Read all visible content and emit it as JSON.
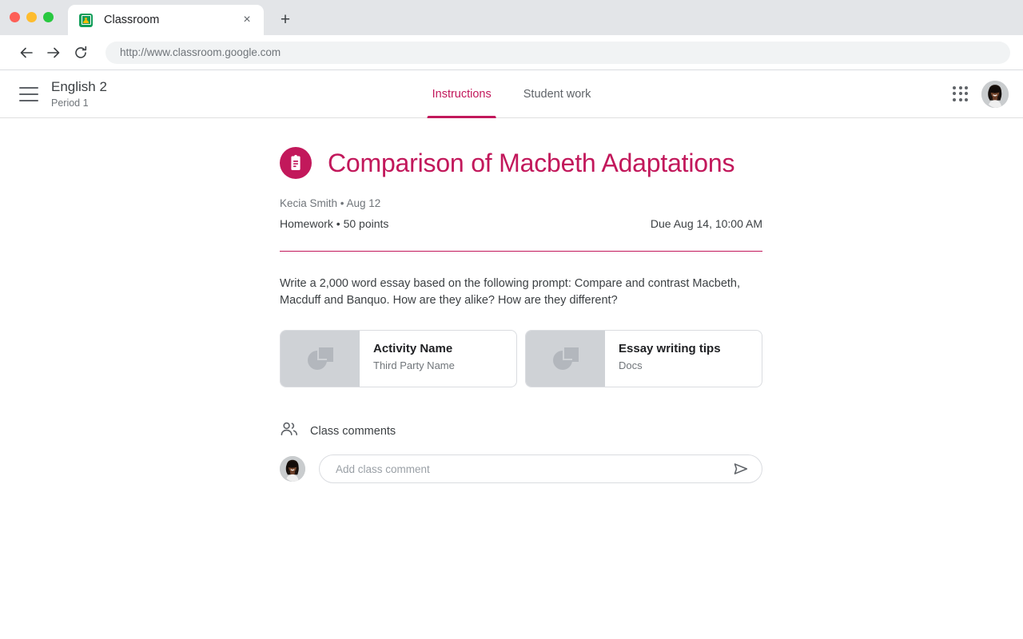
{
  "browser": {
    "tab": {
      "title": "Classroom",
      "favicon": "google-classroom-icon",
      "close_label": "×"
    },
    "new_tab_label": "+",
    "nav": {
      "back": "back-arrow-icon",
      "forward": "forward-arrow-icon",
      "reload": "reload-icon"
    },
    "address_bar": {
      "url": "http://www.classroom.google.com"
    }
  },
  "app_header": {
    "menu_icon": "hamburger-menu-icon",
    "course_name": "English 2",
    "course_section": "Period 1",
    "tabs": [
      {
        "label": "Instructions",
        "active": true
      },
      {
        "label": "Student work",
        "active": false
      }
    ],
    "apps_icon": "apps-grid-icon",
    "avatar": "user-avatar"
  },
  "assignment": {
    "icon": "assignment-clipboard-icon",
    "title": "Comparison of Macbeth Adaptations",
    "author_line": "Kecia Smith  • Aug 12",
    "type_points": "Homework • 50 points",
    "due": "Due Aug 14, 10:00 AM",
    "description": "Write a 2,000 word essay based on the following prompt: Compare and contrast Macbeth, Macduff and Banquo. How are they alike? How are they different?",
    "attachments": [
      {
        "title": "Activity Name",
        "subtitle": "Third Party Name",
        "thumb": "placeholder-thumbnail-icon"
      },
      {
        "title": "Essay writing tips",
        "subtitle": "Docs",
        "thumb": "placeholder-thumbnail-icon"
      }
    ]
  },
  "comments": {
    "icon": "people-icon",
    "label": "Class comments",
    "avatar": "user-avatar",
    "input_placeholder": "Add class comment",
    "input_value": "",
    "send_icon": "send-icon"
  },
  "colors": {
    "accent": "#c2185b",
    "text_primary": "#3c4043",
    "text_secondary": "#70757a",
    "border": "#dadce0",
    "thumb_bg": "#cfd2d6"
  }
}
